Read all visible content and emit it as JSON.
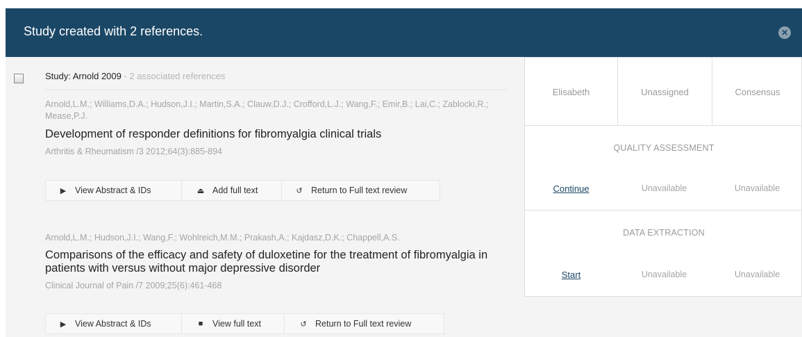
{
  "banner": {
    "message": "Study created with 2 references."
  },
  "study": {
    "label": "Study: Arnold 2009",
    "count_text": " - 2 associated references"
  },
  "references": [
    {
      "authors": "Arnold,L.M.; Williams,D.A.; Hudson,J.I.; Martin,S.A.; Clauw,D.J.; Crofford,L.J.; Wang,F.; Emir,B.; Lai,C.; Zablocki,R.; Mease,P.J.",
      "title": "Development of responder definitions for fibromyalgia clinical trials",
      "journal": "Arthritis & Rheumatism /3 2012;64(3):885-894",
      "buttons": {
        "abstract": "View Abstract & IDs",
        "fulltext": "Add full text",
        "return": "Return to Full text review"
      }
    },
    {
      "authors": "Arnold,L.M.; Hudson,J.I.; Wang,F.; Wohlreich,M.M.; Prakash,A.; Kajdasz,D.K.; Chappell,A.S.",
      "title": "Comparisons of the efficacy and safety of duloxetine for the treatment of fibromyalgia in patients with versus without major depressive disorder",
      "journal": "Clinical Journal of Pain /7 2009;25(6):461-468",
      "buttons": {
        "abstract": "View Abstract & IDs",
        "fulltext": "View full text",
        "return": "Return to Full text review"
      }
    }
  ],
  "columns": [
    "Elisabeth",
    "Unassigned",
    "Consensus"
  ],
  "quality": {
    "title": "QUALITY ASSESSMENT",
    "cells": [
      "Continue",
      "Unavailable",
      "Unavailable"
    ]
  },
  "extraction": {
    "title": "DATA EXTRACTION",
    "cells": [
      "Start",
      "Unavailable",
      "Unavailable"
    ]
  },
  "icons": [
    "close-icon",
    "play-icon",
    "upload-icon",
    "return-icon",
    "document-icon"
  ]
}
